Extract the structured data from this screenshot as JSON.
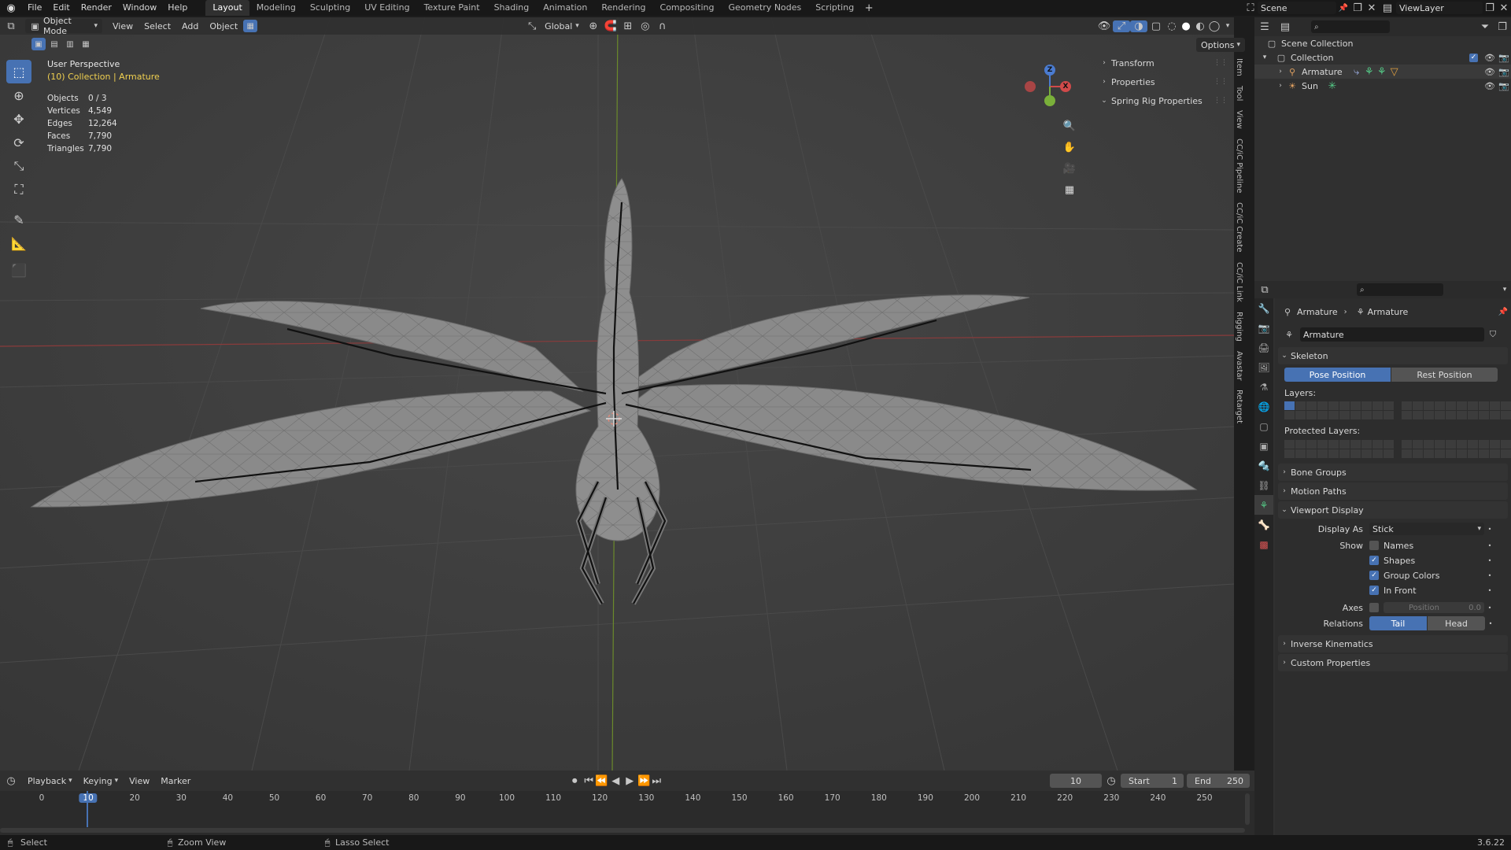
{
  "topbar": {
    "menus": [
      "File",
      "Edit",
      "Render",
      "Window",
      "Help"
    ],
    "workspaces": [
      "Layout",
      "Modeling",
      "Sculpting",
      "UV Editing",
      "Texture Paint",
      "Shading",
      "Animation",
      "Rendering",
      "Compositing",
      "Geometry Nodes",
      "Scripting"
    ],
    "active_workspace": "Layout",
    "scene": "Scene",
    "viewlayer": "ViewLayer"
  },
  "viewport": {
    "mode": "Object Mode",
    "menus": [
      "View",
      "Select",
      "Add",
      "Object"
    ],
    "orientation": "Global",
    "options": "Options",
    "perspective": "User Perspective",
    "collection": "(10) Collection | Armature",
    "stats": [
      {
        "k": "Objects",
        "v": "0 / 3"
      },
      {
        "k": "Vertices",
        "v": "4,549"
      },
      {
        "k": "Edges",
        "v": "12,264"
      },
      {
        "k": "Faces",
        "v": "7,790"
      },
      {
        "k": "Triangles",
        "v": "7,790"
      }
    ]
  },
  "npanel": {
    "items": [
      "Transform",
      "Properties",
      "Spring Rig Properties"
    ],
    "tabs": [
      "Item",
      "Tool",
      "View",
      "CC/iC Pipeline",
      "CC/iC Create",
      "CC/iC Link",
      "Rigging",
      "Avastar",
      "Retarget"
    ]
  },
  "gizmo": {
    "z": "Z",
    "x": "X",
    "y": "Y"
  },
  "outliner": {
    "root": "Scene Collection",
    "collection": "Collection",
    "items": [
      "Armature",
      "Sun"
    ]
  },
  "properties": {
    "breadcrumb": [
      "Armature",
      "Armature"
    ],
    "data_name": "Armature",
    "skeleton": "Skeleton",
    "pose_position": "Pose Position",
    "rest_position": "Rest Position",
    "layers": "Layers:",
    "protected_layers": "Protected Layers:",
    "bone_groups": "Bone Groups",
    "motion_paths": "Motion Paths",
    "viewport_display": "Viewport Display",
    "display_as_label": "Display As",
    "display_as": "Stick",
    "show_label": "Show",
    "show": [
      {
        "label": "Names",
        "on": false
      },
      {
        "label": "Shapes",
        "on": true
      },
      {
        "label": "Group Colors",
        "on": true
      },
      {
        "label": "In Front",
        "on": true
      }
    ],
    "axes_label": "Axes",
    "axes_position": "Position",
    "axes_value": "0.0",
    "relations_label": "Relations",
    "tail": "Tail",
    "head": "Head",
    "inverse_kinematics": "Inverse Kinematics",
    "custom_properties": "Custom Properties"
  },
  "timeline": {
    "menus": [
      "Playback",
      "Keying",
      "View",
      "Marker"
    ],
    "current": "10",
    "start_label": "Start",
    "start": "1",
    "end_label": "End",
    "end": "250",
    "ticks": [
      "0",
      "10",
      "20",
      "30",
      "40",
      "50",
      "60",
      "70",
      "80",
      "90",
      "100",
      "110",
      "120",
      "130",
      "140",
      "150",
      "160",
      "170",
      "180",
      "190",
      "200",
      "210",
      "220",
      "230",
      "240",
      "250"
    ]
  },
  "statusbar": {
    "select": "Select",
    "zoom": "Zoom View",
    "lasso": "Lasso Select",
    "version": "3.6.22"
  }
}
